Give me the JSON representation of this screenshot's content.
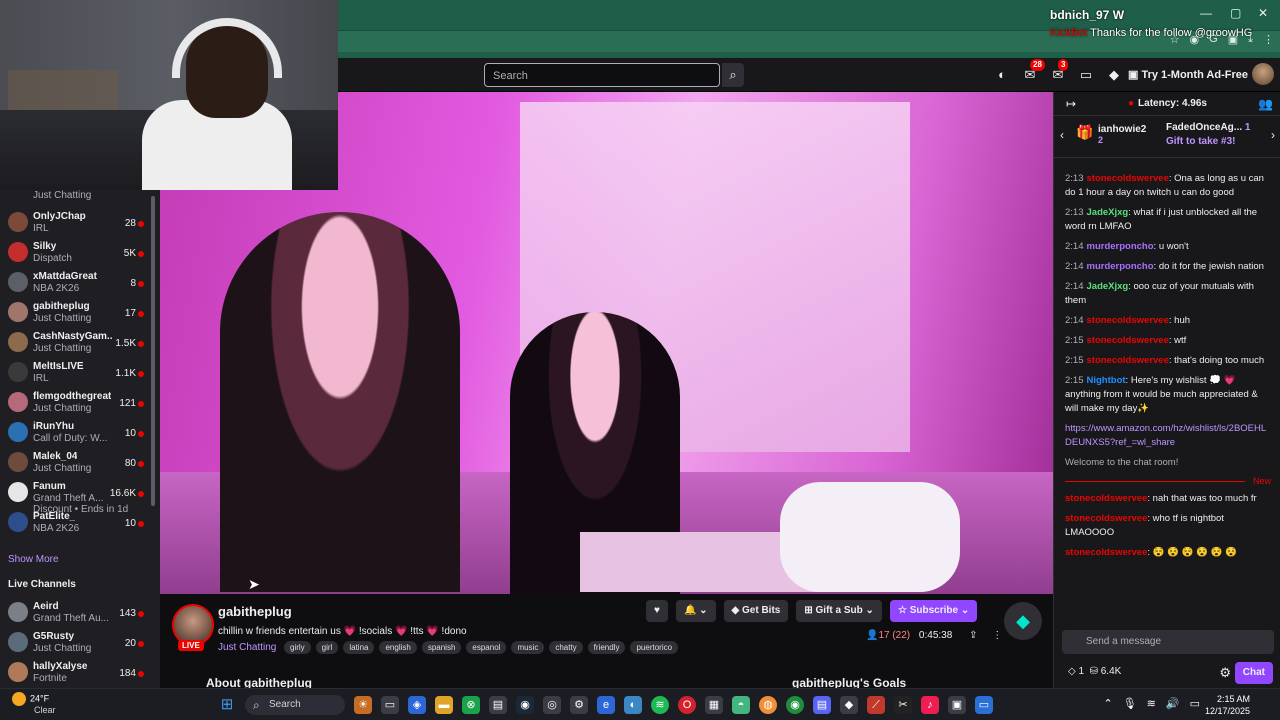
{
  "overlay": {
    "alert_user": "bdnich_97",
    "alert_suffix": "W",
    "bot_name": "KickBot",
    "bot_message": "Thanks for the follow @groowHG"
  },
  "nav": {
    "search_placeholder": "Search",
    "notif_count": "28",
    "inbox_count": "3",
    "try_label": "Try 1-Month Ad-Free"
  },
  "sidebar": {
    "top_category": "Just Chatting",
    "channels": [
      {
        "name": "OnlyJChap",
        "category": "IRL",
        "viewers": "28",
        "color": "#7b4a3a"
      },
      {
        "name": "Silky",
        "category": "Dispatch",
        "viewers": "5K",
        "color": "#c22d2d"
      },
      {
        "name": "xMattdaGreat",
        "category": "NBA 2K26",
        "viewers": "8",
        "color": "#5c5f66"
      },
      {
        "name": "gabitheplug",
        "category": "Just Chatting",
        "viewers": "17",
        "color": "#a0766a"
      },
      {
        "name": "CashNastyGam...",
        "category": "Just Chatting",
        "viewers": "1.5K",
        "color": "#8c6a4c"
      },
      {
        "name": "MeltIsLIVE",
        "category": "IRL",
        "viewers": "1.1K",
        "color": "#3a3a3a"
      },
      {
        "name": "flemgodthegreat",
        "category": "Just Chatting",
        "viewers": "121",
        "color": "#b5697a"
      },
      {
        "name": "iRunYhu",
        "category": "Call of Duty: W...",
        "viewers": "10",
        "color": "#2d6fb3"
      },
      {
        "name": "Malek_04",
        "category": "Just Chatting",
        "viewers": "80",
        "color": "#6e4b3c"
      },
      {
        "name": "Fanum",
        "category": "Grand Theft A...",
        "viewers": "16.6K",
        "color": "#e6e6e6"
      },
      {
        "name": "PatElite_",
        "category": "NBA 2K26",
        "viewers": "10",
        "color": "#2c4e8a"
      }
    ],
    "discount": "Discount • Ends in 1d",
    "show_more": "Show More",
    "live_header": "Live Channels",
    "live": [
      {
        "name": "Aeird",
        "category": "Grand Theft Au...",
        "viewers": "143",
        "color": "#7a7f88"
      },
      {
        "name": "G5Rusty",
        "category": "Just Chatting",
        "viewers": "20",
        "color": "#5a6b7a"
      },
      {
        "name": "hallyXalyse",
        "category": "Fortnite",
        "viewers": "184",
        "color": "#b07a5a"
      }
    ]
  },
  "stream": {
    "channel": "gabitheplug",
    "title": "chillin w friends entertain us 💗 !socials 💗 !tts 💗 !dono",
    "live": "LIVE",
    "category": "Just Chatting",
    "tags": [
      "girly",
      "girl",
      "latina",
      "english",
      "spanish",
      "espanol",
      "music",
      "chatty",
      "friendly",
      "puertorico"
    ],
    "get_bits": "Get Bits",
    "gift_sub": "Gift a Sub",
    "subscribe": "Subscribe",
    "viewers": "17 (22)",
    "uptime": "0:45:38",
    "about": "About gabitheplug",
    "goals": "gabitheplug's Goals"
  },
  "chat": {
    "latency": "Latency: 4.96s",
    "gift1_user": "ianhowie2",
    "gift1_count": "2",
    "gift2_user": "FadedOnceAg...",
    "gift2_count": "1",
    "gift2_label": "Gift to take #3!",
    "messages": [
      {
        "t": "2:13",
        "u": "stonecoldswervee",
        "c": "u-red",
        "m": "Ona as long as u can do 1 hour a day on twitch u can do good"
      },
      {
        "t": "2:13",
        "u": "JadeXjxg",
        "c": "u-green",
        "m": "what if i just unblocked all the word rn LMFAO"
      },
      {
        "t": "2:14",
        "u": "murderponcho",
        "c": "u-purple",
        "m": "u won't"
      },
      {
        "t": "2:14",
        "u": "murderponcho",
        "c": "u-purple",
        "m": "do it for the jewish nation"
      },
      {
        "t": "2:14",
        "u": "JadeXjxg",
        "c": "u-green",
        "m": "ooo cuz of your mutuals with them"
      },
      {
        "t": "2:14",
        "u": "stonecoldswervee",
        "c": "u-red",
        "m": "huh"
      },
      {
        "t": "2:15",
        "u": "stonecoldswervee",
        "c": "u-red",
        "m": "wtf"
      },
      {
        "t": "2:15",
        "u": "stonecoldswervee",
        "c": "u-red",
        "m": "that's doing too much"
      },
      {
        "t": "2:15",
        "u": "Nightbot",
        "c": "u-blue",
        "m": "Here's my wishlist 💭 💗 anything from it would be much appreciated & will make my day✨"
      }
    ],
    "wishlist_link": "https://www.amazon.com/hz/wishlist/ls/2BOEHLDEUNXS5?ref_=wl_share",
    "welcome": "Welcome to the chat room!",
    "new_label": "New",
    "after": [
      {
        "u": "stonecoldswervee",
        "m": "nah that was too much fr"
      },
      {
        "u": "stonecoldswervee",
        "m": "who tf is nightbot LMAOOOO"
      },
      {
        "u": "stonecoldswervee",
        "m": "😵 😵 😵 😵 😵 😵"
      }
    ],
    "input_placeholder": "Send a message",
    "points": "1",
    "bits": "6.4K",
    "chat_button": "Chat"
  },
  "taskbar": {
    "temp": "24°F",
    "weather": "Clear",
    "search": "Search",
    "time": "2:15 AM",
    "date": "12/17/2025"
  }
}
